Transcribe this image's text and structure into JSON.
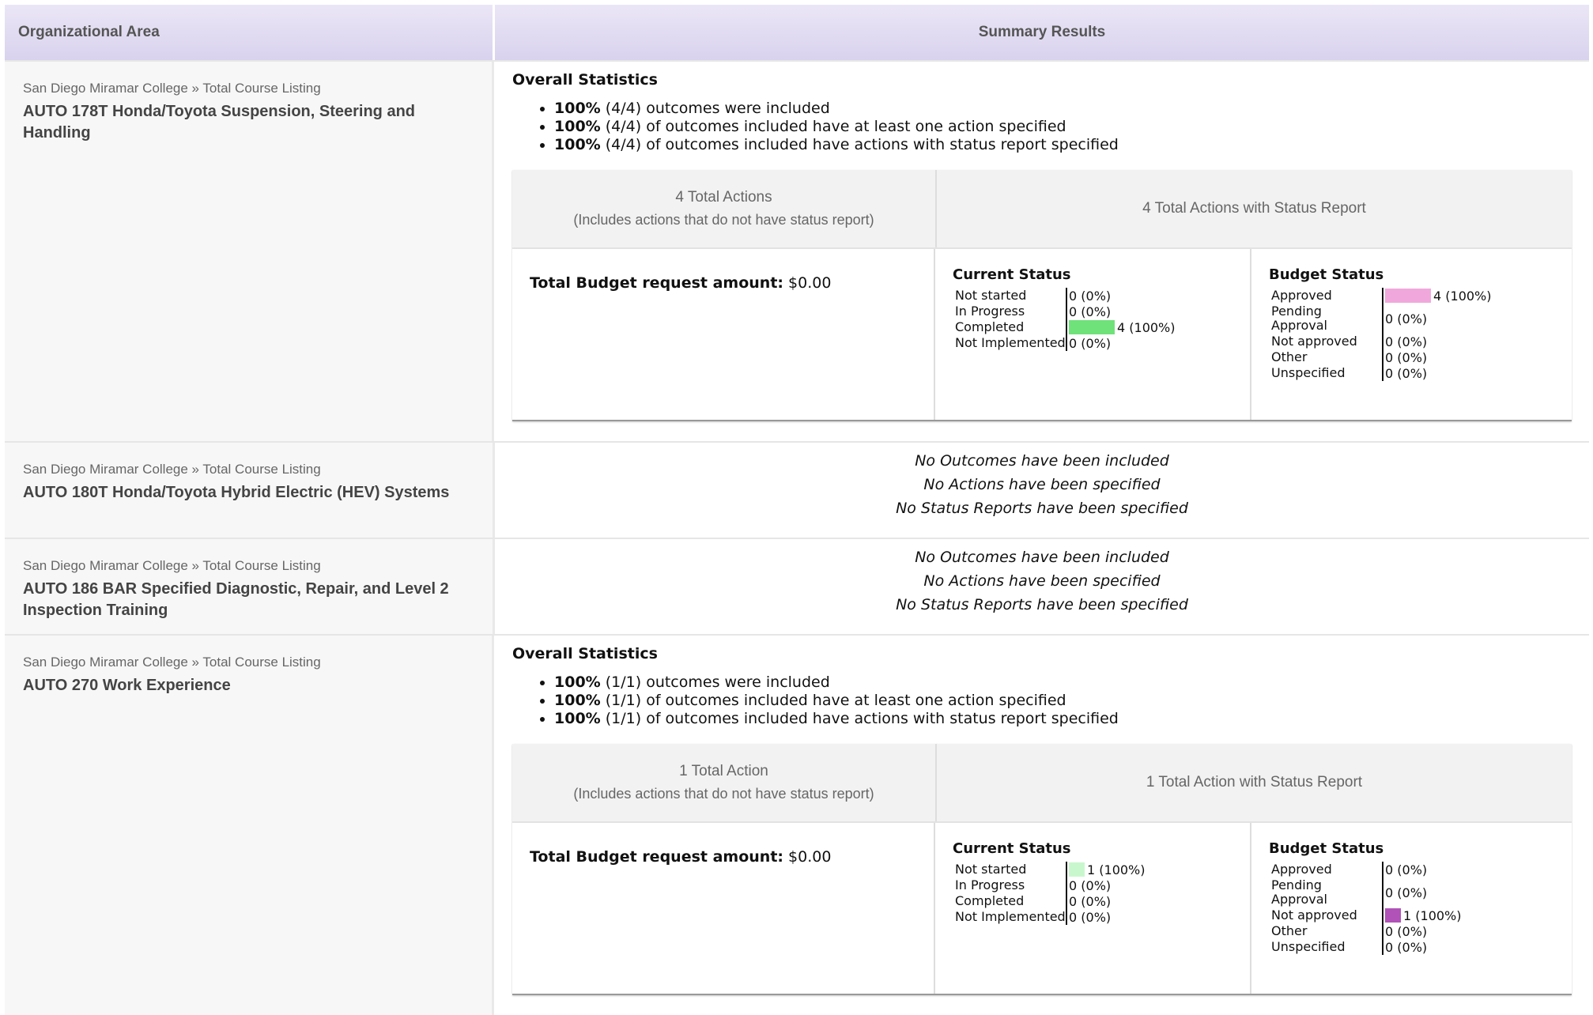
{
  "header": {
    "org_col": "Organizational Area",
    "summary_col": "Summary Results"
  },
  "colors": {
    "completed": "#6fe27a",
    "not_started": "#c9f7cd",
    "approved": "#f0a8dc",
    "not_approved": "#b052b8"
  },
  "rows": [
    {
      "crumb": "San Diego Miramar College » Total Course Listing",
      "course": "AUTO 178T Honda/Toyota Suspension, Steering and Handling",
      "overall_title": "Overall Statistics",
      "stats": [
        {
          "pct": "100%",
          "text": "(4/4) outcomes were included"
        },
        {
          "pct": "100%",
          "text": "(4/4) of outcomes included have at least one action specified"
        },
        {
          "pct": "100%",
          "text": "(4/4) of outcomes included have actions with status report specified"
        }
      ],
      "total_actions": "4 Total Actions",
      "total_actions_sub": "(Includes actions that do not have status report)",
      "actions_with_status": "4 Total Actions with Status Report",
      "budget_label": "Total Budget request amount:",
      "budget_value": "$0.00",
      "current_status_title": "Current Status",
      "current_status": [
        {
          "label": "Not started",
          "value": "0 (0%)",
          "fraction": 0
        },
        {
          "label": "In Progress",
          "value": "0 (0%)",
          "fraction": 0
        },
        {
          "label": "Completed",
          "value": "4 (100%)",
          "fraction": 1
        },
        {
          "label": "Not Implemented",
          "value": "0 (0%)",
          "fraction": 0
        }
      ],
      "budget_status_title": "Budget Status",
      "budget_status": [
        {
          "label": "Approved",
          "value": "4 (100%)",
          "fraction": 1
        },
        {
          "label": "Pending Approval",
          "value": "0 (0%)",
          "fraction": 0
        },
        {
          "label": "Not approved",
          "value": "0 (0%)",
          "fraction": 0
        },
        {
          "label": "Other",
          "value": "0 (0%)",
          "fraction": 0
        },
        {
          "label": "Unspecified",
          "value": "0 (0%)",
          "fraction": 0
        }
      ]
    },
    {
      "crumb": "San Diego Miramar College » Total Course Listing",
      "course": "AUTO 180T Honda/Toyota Hybrid Electric (HEV) Systems",
      "empty_lines": [
        "No Outcomes have been included",
        "No Actions have been specified",
        "No Status Reports have been specified"
      ]
    },
    {
      "crumb": "San Diego Miramar College » Total Course Listing",
      "course": "AUTO 186 BAR Specified Diagnostic, Repair, and Level 2 Inspection Training",
      "empty_lines": [
        "No Outcomes have been included",
        "No Actions have been specified",
        "No Status Reports have been specified"
      ]
    },
    {
      "crumb": "San Diego Miramar College » Total Course Listing",
      "course": "AUTO 270 Work Experience",
      "overall_title": "Overall Statistics",
      "stats": [
        {
          "pct": "100%",
          "text": "(1/1) outcomes were included"
        },
        {
          "pct": "100%",
          "text": "(1/1) of outcomes included have at least one action specified"
        },
        {
          "pct": "100%",
          "text": "(1/1) of outcomes included have actions with status report specified"
        }
      ],
      "total_actions": "1 Total Action",
      "total_actions_sub": "(Includes actions that do not have status report)",
      "actions_with_status": "1 Total Action with Status Report",
      "budget_label": "Total Budget request amount:",
      "budget_value": "$0.00",
      "current_status_title": "Current Status",
      "current_status": [
        {
          "label": "Not started",
          "value": "1 (100%)",
          "fraction": 1
        },
        {
          "label": "In Progress",
          "value": "0 (0%)",
          "fraction": 0
        },
        {
          "label": "Completed",
          "value": "0 (0%)",
          "fraction": 0
        },
        {
          "label": "Not Implemented",
          "value": "0 (0%)",
          "fraction": 0
        }
      ],
      "budget_status_title": "Budget Status",
      "budget_status": [
        {
          "label": "Approved",
          "value": "0 (0%)",
          "fraction": 0
        },
        {
          "label": "Pending Approval",
          "value": "0 (0%)",
          "fraction": 0
        },
        {
          "label": "Not approved",
          "value": "1 (100%)",
          "fraction": 1
        },
        {
          "label": "Other",
          "value": "0 (0%)",
          "fraction": 0
        },
        {
          "label": "Unspecified",
          "value": "0 (0%)",
          "fraction": 0
        }
      ]
    }
  ]
}
